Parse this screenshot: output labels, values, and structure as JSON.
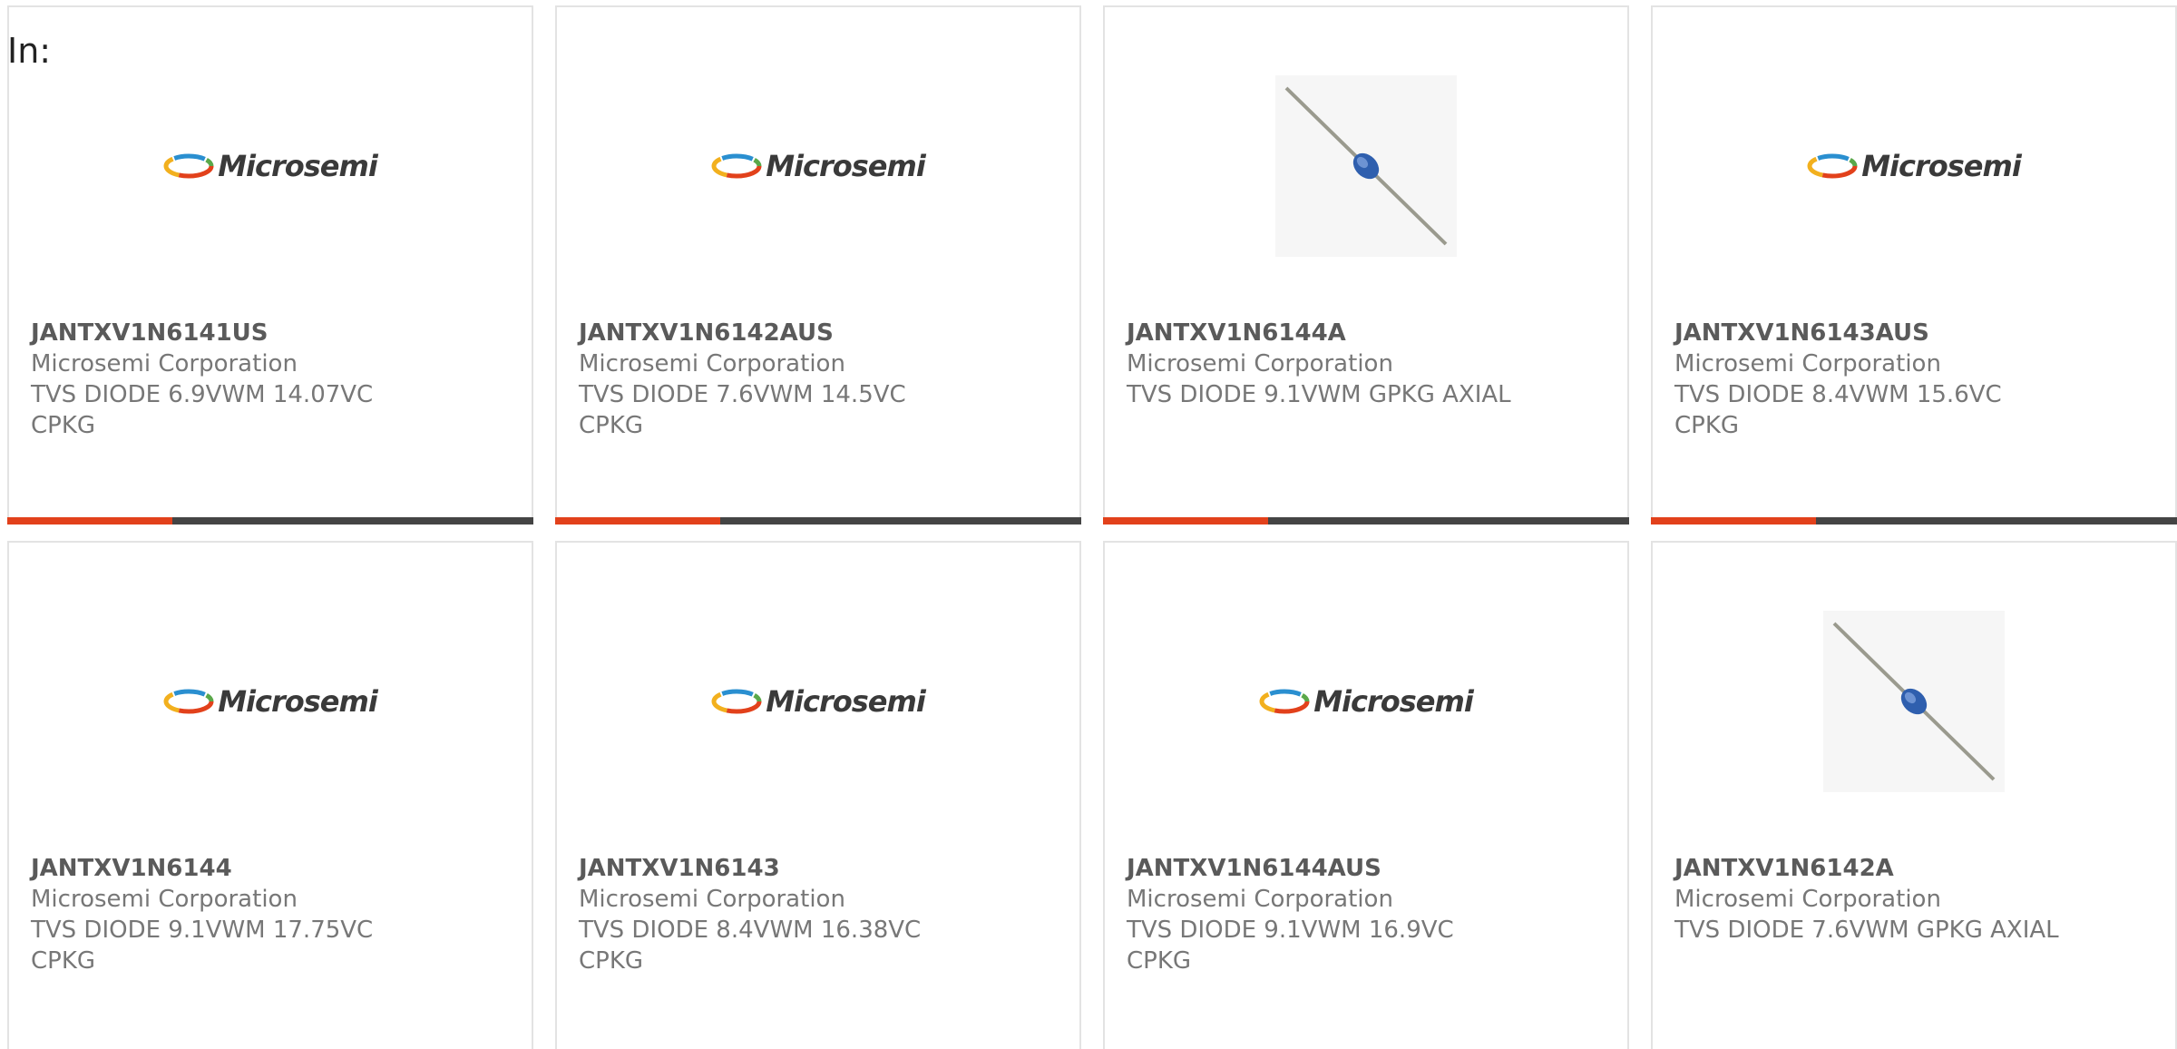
{
  "header": {
    "label": "In:"
  },
  "brand": {
    "logo_text": "Microsemi",
    "accent_color": "#e2411b",
    "bar_color": "#444444"
  },
  "products": [
    {
      "part": "JANTXV1N6141US",
      "manufacturer": "Microsemi Corporation",
      "description": "TVS DIODE 6.9VWM 14.07VC CPKG",
      "image": "microsemi-logo"
    },
    {
      "part": "JANTXV1N6142AUS",
      "manufacturer": "Microsemi Corporation",
      "description": "TVS DIODE 7.6VWM 14.5VC CPKG",
      "image": "microsemi-logo"
    },
    {
      "part": "JANTXV1N6144A",
      "manufacturer": "Microsemi Corporation",
      "description": "TVS DIODE 9.1VWM GPKG AXIAL",
      "image": "axial-diode-photo"
    },
    {
      "part": "JANTXV1N6143AUS",
      "manufacturer": "Microsemi Corporation",
      "description": "TVS DIODE 8.4VWM 15.6VC CPKG",
      "image": "microsemi-logo"
    },
    {
      "part": "JANTXV1N6144",
      "manufacturer": "Microsemi Corporation",
      "description": "TVS DIODE 9.1VWM 17.75VC CPKG",
      "image": "microsemi-logo"
    },
    {
      "part": "JANTXV1N6143",
      "manufacturer": "Microsemi Corporation",
      "description": "TVS DIODE 8.4VWM 16.38VC CPKG",
      "image": "microsemi-logo"
    },
    {
      "part": "JANTXV1N6144AUS",
      "manufacturer": "Microsemi Corporation",
      "description": "TVS DIODE 9.1VWM 16.9VC CPKG",
      "image": "microsemi-logo"
    },
    {
      "part": "JANTXV1N6142A",
      "manufacturer": "Microsemi Corporation",
      "description": "TVS DIODE 7.6VWM GPKG AXIAL",
      "image": "axial-diode-photo"
    }
  ]
}
